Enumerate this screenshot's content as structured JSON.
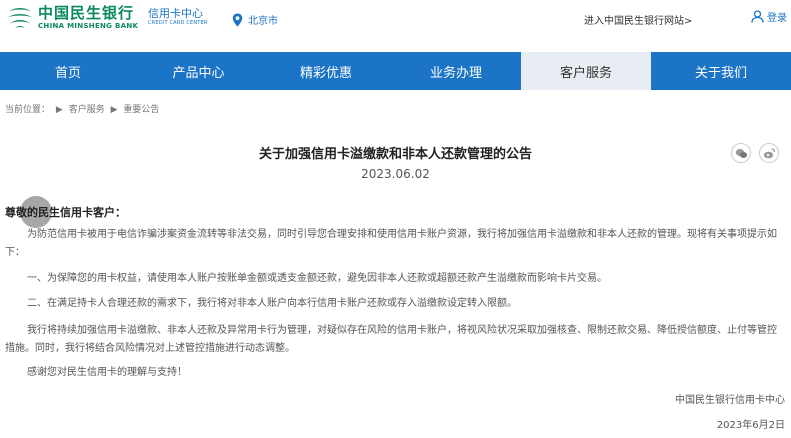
{
  "header": {
    "logo_cn": "中国民生银行",
    "logo_en": "CHINA MINSHENG BANK",
    "sub_cn": "信用卡中心",
    "sub_en": "CREDIT CARD CENTER",
    "location": "北京市",
    "home_link": "进入中国民生银行网站>",
    "login": "登录",
    "brand_color": "#0a8a5b",
    "accent_color": "#1b74c5"
  },
  "nav": {
    "items": [
      {
        "label": "首页"
      },
      {
        "label": "产品中心"
      },
      {
        "label": "精彩优惠"
      },
      {
        "label": "业务办理"
      },
      {
        "label": "客户服务"
      },
      {
        "label": "关于我们"
      }
    ],
    "active": "客户服务"
  },
  "breadcrumb": {
    "prefix": "当前位置：",
    "sep": "▶",
    "items": [
      "客户服务",
      "重要公告"
    ]
  },
  "article": {
    "title": "关于加强信用卡溢缴款和非本人还款管理的公告",
    "date": "2023.06.02",
    "salutation": "尊敬的民生信用卡客户：",
    "paragraphs": [
      "为防范信用卡被用于电信诈骗涉案资金流转等非法交易，同时引导您合理安排和使用信用卡账户资源，我行将加强信用卡溢缴款和非本人还款的管理。现将有关事项提示如下：",
      "一、为保障您的用卡权益，请使用本人账户按账单金额或透支金额还款，避免因非本人还款或超额还款产生溢缴款而影响卡片交易。",
      "二、在满足持卡人合理还款的需求下，我行将对非本人账户向本行信用卡账户还款或存入溢缴款设定转入限额。",
      "我行将持续加强信用卡溢缴款、非本人还款及异常用卡行为管理，对疑似存在风险的信用卡账户，将视风险状况采取加强核查、限制还款交易、降低授信额度、止付等管控措施。同时，我行将结合风险情况对上述管控措施进行动态调整。",
      "感谢您对民生信用卡的理解与支持！"
    ],
    "signature": "中国民生银行信用卡中心",
    "sign_date": "2023年6月2日",
    "share": [
      "wechat-icon",
      "weibo-icon"
    ]
  }
}
